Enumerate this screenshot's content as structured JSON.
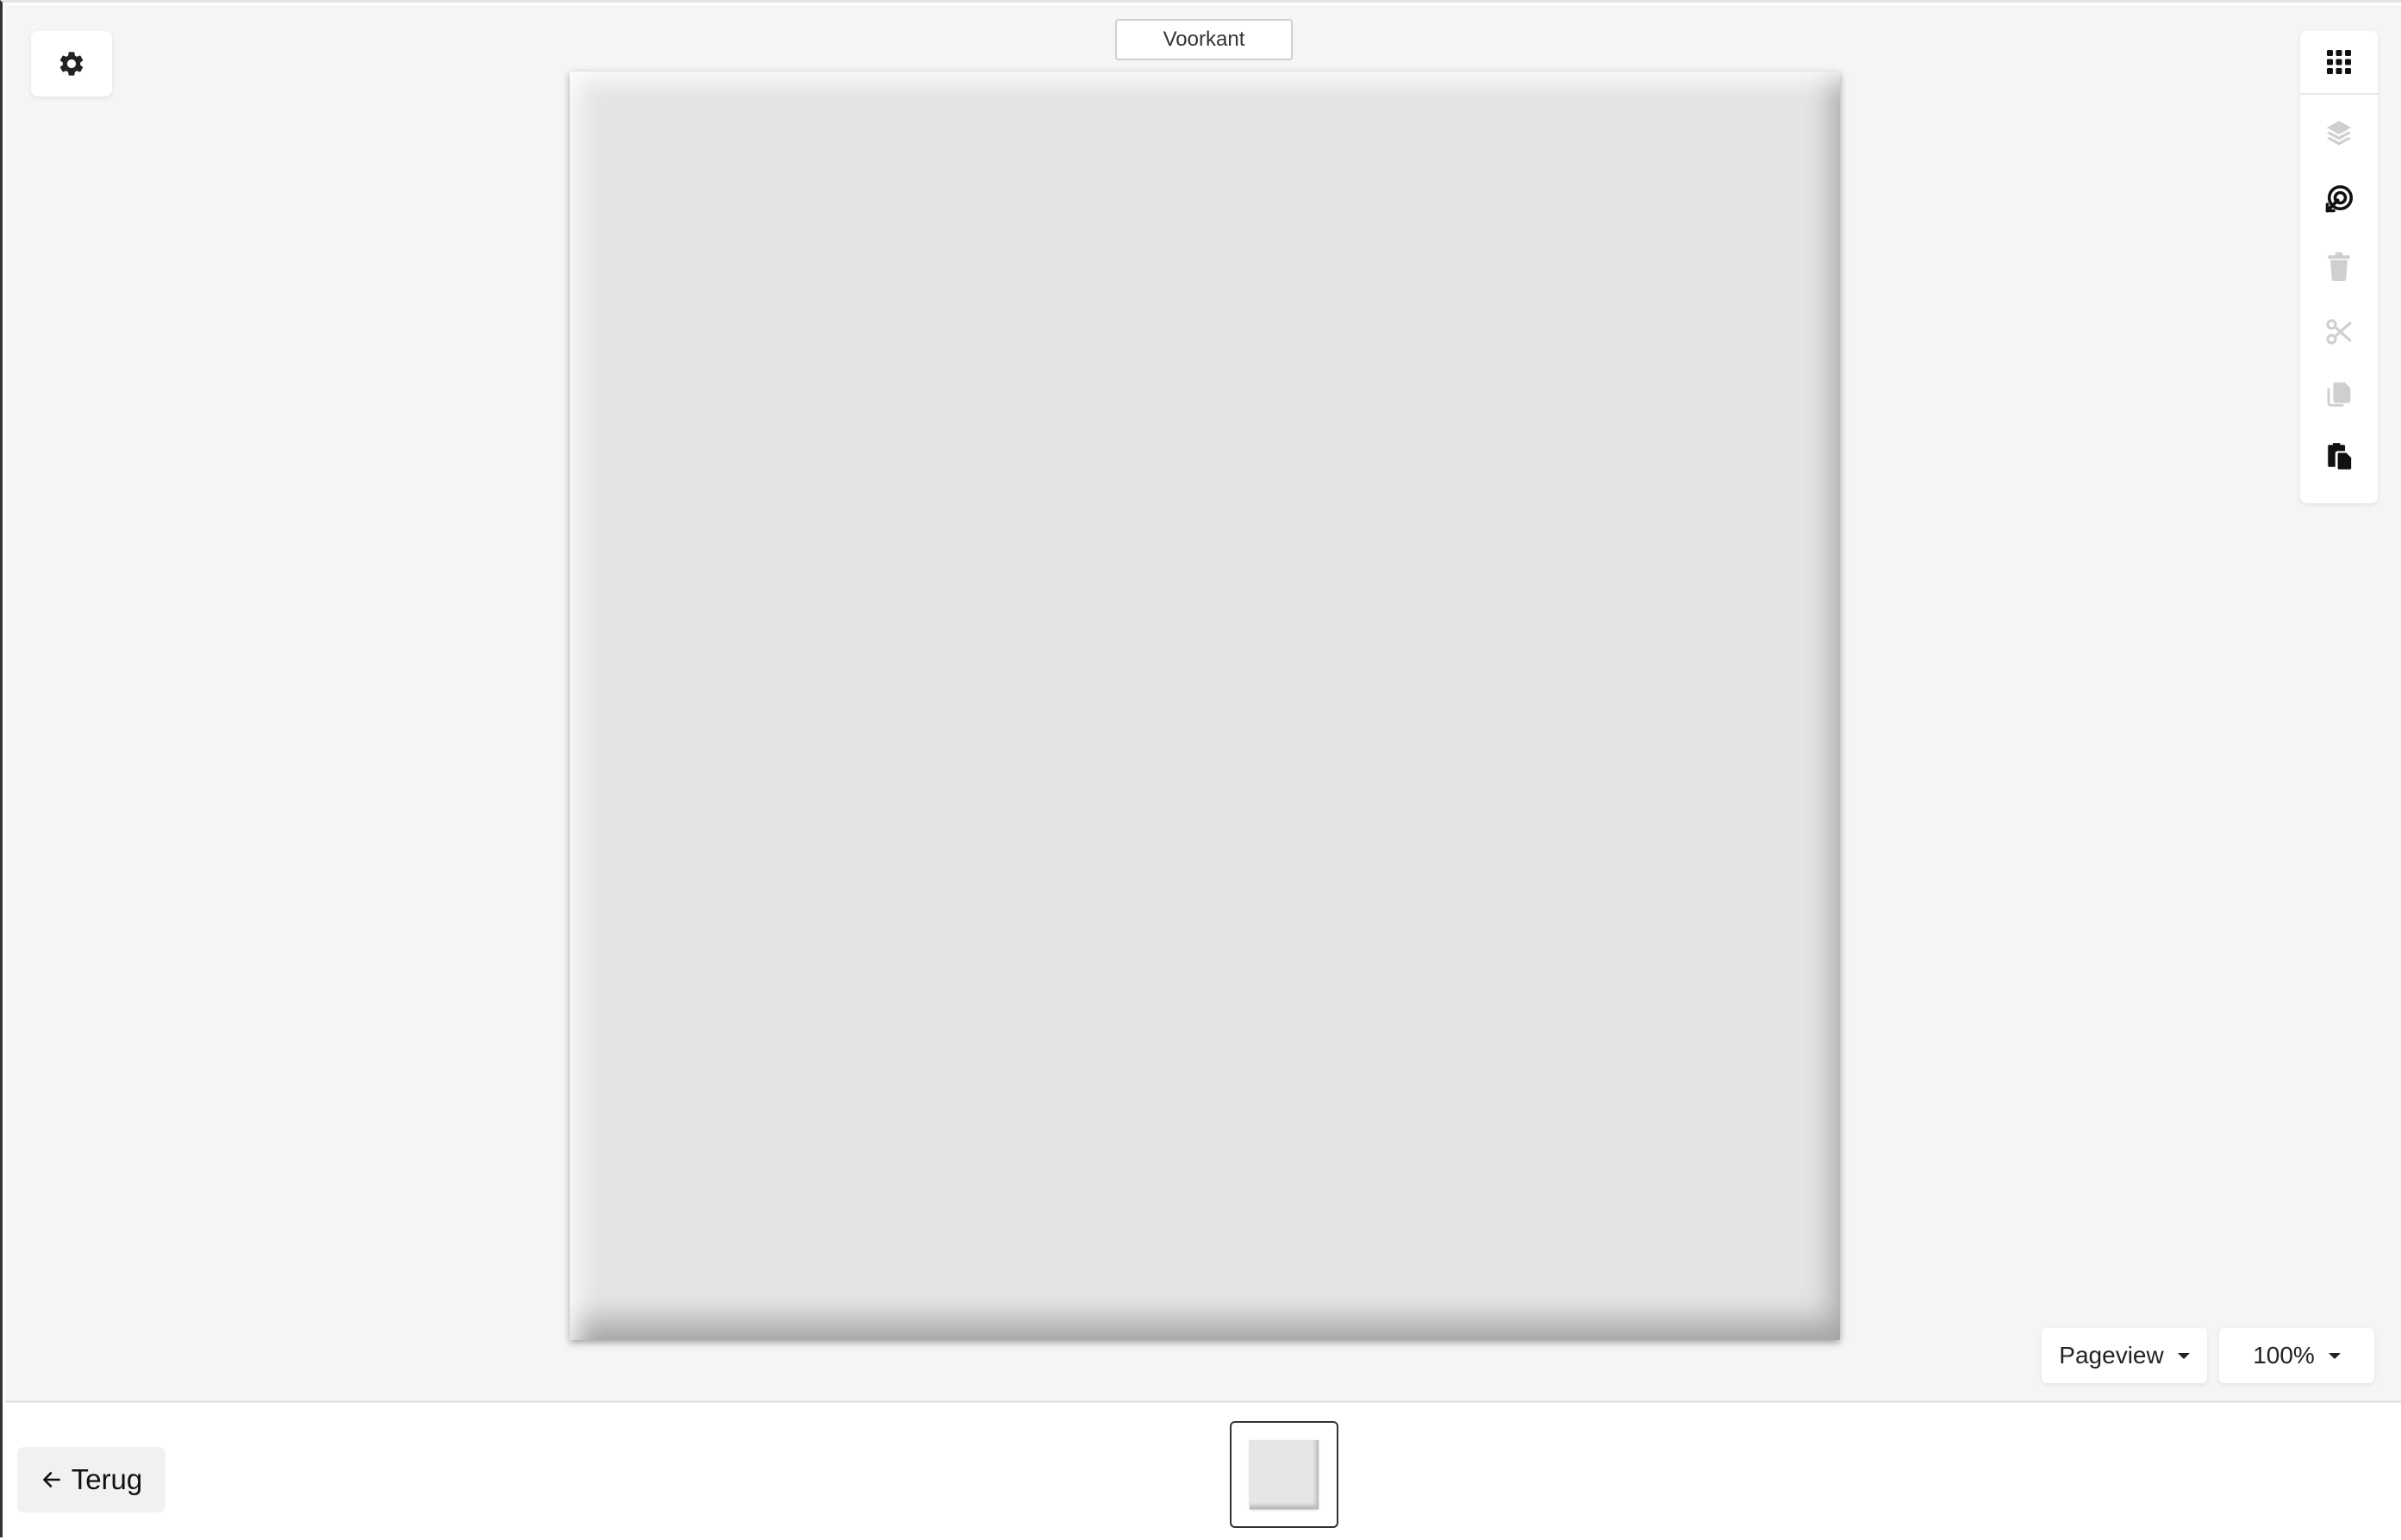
{
  "canvas": {
    "side_label": "Voorkant"
  },
  "settings": {
    "icon": "gear-icon"
  },
  "toolbar": {
    "tools": [
      {
        "name": "apps-grid",
        "icon": "grid-icon",
        "enabled": true
      },
      {
        "name": "layers",
        "icon": "layers-icon",
        "enabled": false
      },
      {
        "name": "focus-target",
        "icon": "target-arrow-icon",
        "enabled": true
      },
      {
        "name": "delete",
        "icon": "trash-icon",
        "enabled": false
      },
      {
        "name": "cut",
        "icon": "scissors-icon",
        "enabled": false
      },
      {
        "name": "copy",
        "icon": "copy-icon",
        "enabled": false
      },
      {
        "name": "paste",
        "icon": "paste-icon",
        "enabled": true
      }
    ],
    "enabled_color": "#111111",
    "disabled_color": "#cfcfcf"
  },
  "view": {
    "mode_label": "Pageview",
    "zoom_label": "100%"
  },
  "footer": {
    "back_label": "Terug"
  }
}
